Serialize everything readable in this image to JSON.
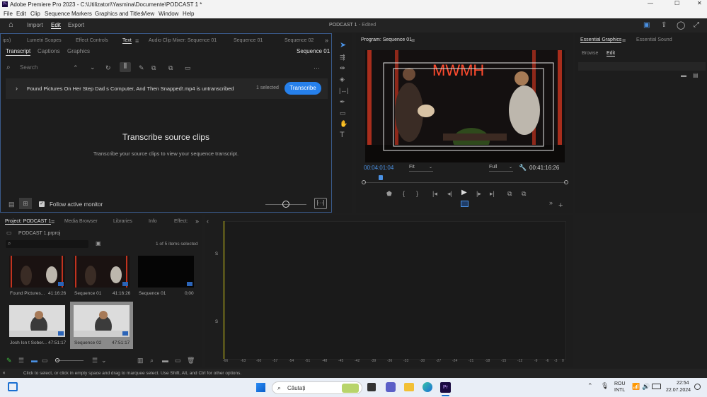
{
  "window": {
    "title": "Adobe Premiere Pro 2023 - C:\\Utilizatori\\Yasmina\\Documente\\PODCAST 1 *"
  },
  "menu": [
    "File",
    "Edit",
    "Clip",
    "Sequence",
    "Markers",
    "Graphics and Titles",
    "View",
    "Window",
    "Help"
  ],
  "workspace": {
    "import": "Import",
    "edit": "Edit",
    "export": "Export",
    "project_title": "PODCAST 1",
    "status": "- Edited"
  },
  "top_tabs": [
    "ips)",
    "Lumetri Scopes",
    "Effect Controls",
    "Text",
    "Audio Clip Mixer: Sequence 01",
    "Sequence 01",
    "Sequence 02"
  ],
  "text_panel": {
    "subtabs": [
      "Transcript",
      "Captions",
      "Graphics"
    ],
    "sequence": "Sequence 01",
    "search_placeholder": "Search",
    "clip_row": "Found Pictures On Her Step Dad s Computer, And Then Snapped!.mp4 is untranscribed",
    "selected": "1 selected",
    "transcribe_btn": "Transcribe",
    "heading": "Transcribe source clips",
    "sub": "Transcribe your source clips to view your sequence transcript.",
    "follow": "Follow active monitor"
  },
  "program": {
    "title": "Program: Sequence 01",
    "timecode": "00:04:01:04",
    "fit": "Fit",
    "quality": "Full",
    "duration": "00:41:16:26",
    "sign": "MWMH"
  },
  "essential": {
    "tab1": "Essential Graphics",
    "tab2": "Essential Sound",
    "browse": "Browse",
    "edit": "Edit"
  },
  "project": {
    "tabs": [
      "Project: PODCAST 1",
      "Media Browser",
      "Libraries",
      "Info",
      "Effect:"
    ],
    "file": "PODCAST 1.prproj",
    "count": "1 of 5 items selected",
    "items": [
      {
        "name": "Found Pictures...",
        "dur": "41:16:26"
      },
      {
        "name": "Sequence 01",
        "dur": "41:16:26"
      },
      {
        "name": "Sequence 01",
        "dur": "0;00"
      },
      {
        "name": "Josh Isn t Sober...",
        "dur": "47:51:17"
      },
      {
        "name": "Sequence 02",
        "dur": "47:51:17"
      }
    ]
  },
  "audio_meter": {
    "scale": [
      "-66",
      "-63",
      "-60",
      "-57",
      "-54",
      "-51",
      "-48",
      "-45",
      "-42",
      "-39",
      "-36",
      "-33",
      "-30",
      "-27",
      "-24",
      "-21",
      "-18",
      "-15",
      "-12",
      "-9",
      "-6",
      "-3",
      "0"
    ],
    "s": "S"
  },
  "status_bar": "Click to select, or click in empty space and drag to marquee select. Use Shift, Alt, and Ctrl for other options.",
  "taskbar": {
    "search": "Căutați",
    "lang1": "ROU",
    "lang2": "INTL",
    "time": "22:54",
    "date": "22.07.2024"
  }
}
